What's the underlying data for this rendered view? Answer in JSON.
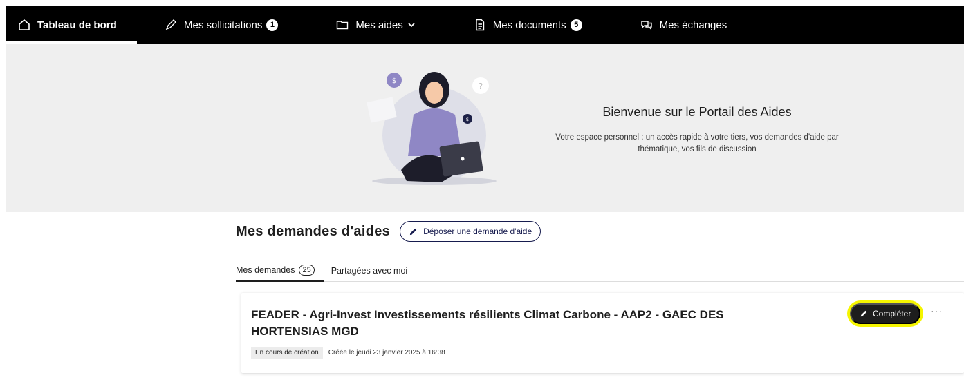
{
  "nav": {
    "items": [
      {
        "label": "Tableau de bord",
        "icon": "home-icon"
      },
      {
        "label": "Mes sollicitations",
        "icon": "pen-icon",
        "badge": "1"
      },
      {
        "label": "Mes aides",
        "icon": "folder-icon"
      },
      {
        "label": "Mes documents",
        "icon": "document-icon",
        "badge": "5"
      },
      {
        "label": "Mes échanges",
        "icon": "chat-icon"
      }
    ]
  },
  "hero": {
    "title": "Bienvenue sur le Portail des Aides",
    "subtitle": "Votre espace personnel : un accès rapide à votre tiers, vos demandes d'aide par thématique, vos fils de discussion"
  },
  "section": {
    "title": "Mes demandes d'aides",
    "deposit_label": "Déposer une demande d'aide"
  },
  "tabs": [
    {
      "label": "Mes demandes",
      "count": "25"
    },
    {
      "label": "Partagées avec moi"
    }
  ],
  "card": {
    "title": "FEADER - Agri-Invest Investissements résilients Climat Carbone - AAP2 - GAEC DES HORTENSIAS MGD",
    "status": "En cours de création",
    "created": "Créée le jeudi 23 janvier 2025 à 16:38",
    "complete_label": "Compléter",
    "more_label": "···"
  },
  "colors": {
    "navbar": "#000000",
    "hero_bg": "#efefef",
    "accent": "#161b4e",
    "highlight": "#f5f500",
    "illustration": "#8f87c5"
  }
}
